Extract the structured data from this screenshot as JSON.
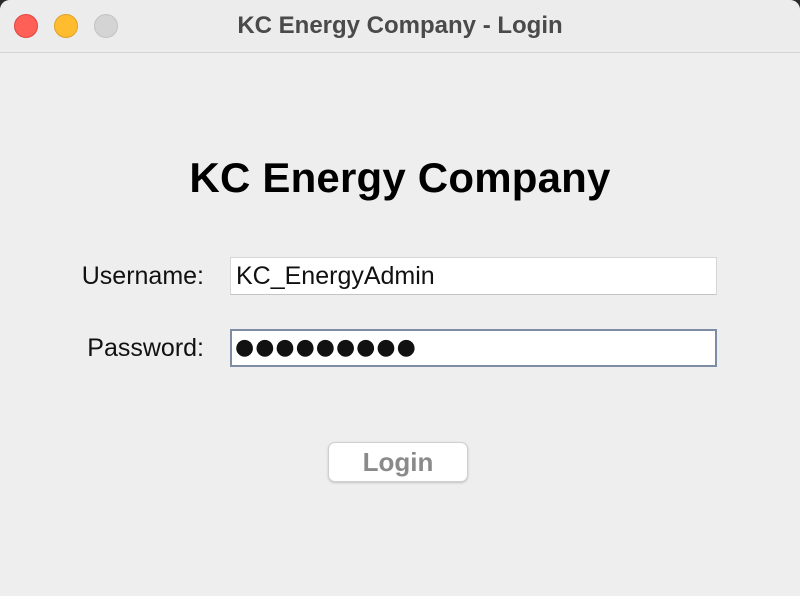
{
  "window": {
    "title": "KC Energy Company - Login",
    "controls": [
      "close",
      "minimize",
      "zoom"
    ]
  },
  "form": {
    "heading": "KC Energy Company",
    "username_label": "Username:",
    "username_value": "KC_EnergyAdmin",
    "password_label": "Password:",
    "password_value": "●●●●●●●●●",
    "login_label": "Login"
  },
  "colors": {
    "close": "#fe5f57",
    "minimize": "#febc2e",
    "zoom": "#d4d4d4",
    "focus_border": "#7e8da3"
  }
}
